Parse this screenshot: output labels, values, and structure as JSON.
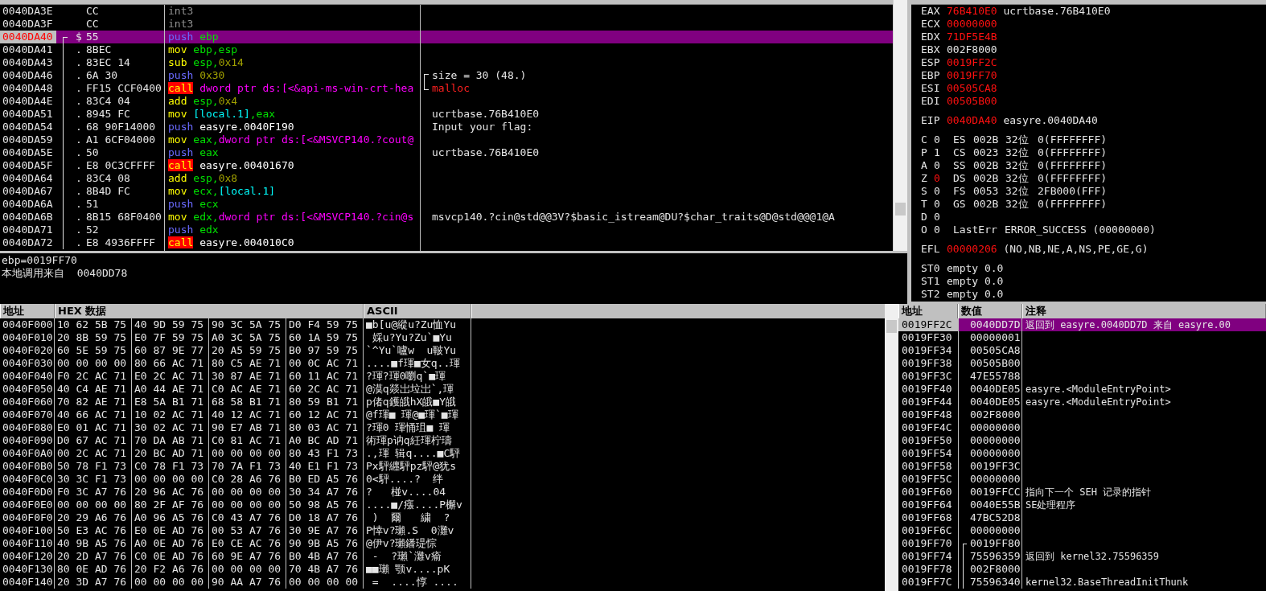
{
  "disassembly": {
    "rows": [
      {
        "address": "0040DA3E",
        "marker": "",
        "in_block": false,
        "hex": "CC",
        "instr": {
          "mnemonic": "int3",
          "kind": "nop"
        },
        "selected": false,
        "current": false
      },
      {
        "address": "0040DA3F",
        "marker": "",
        "in_block": false,
        "hex": "CC",
        "instr": {
          "mnemonic": "int3",
          "kind": "nop"
        },
        "selected": false,
        "current": false
      },
      {
        "address": "0040DA40",
        "marker": "$",
        "in_block": true,
        "hex": "55",
        "instr": {
          "mnemonic": "push",
          "kind": "push",
          "operands": [
            {
              "t": "ebp",
              "kind": "reg"
            }
          ]
        },
        "selected": true,
        "current": true
      },
      {
        "address": "0040DA41",
        "marker": ".",
        "in_block": true,
        "hex": "8BEC",
        "instr": {
          "mnemonic": "mov",
          "kind": "arith",
          "operands": [
            {
              "t": "ebp,esp",
              "kind": "reg"
            }
          ]
        },
        "selected": false,
        "current": false
      },
      {
        "address": "0040DA43",
        "marker": ".",
        "in_block": true,
        "hex": "83EC 14",
        "instr": {
          "mnemonic": "sub",
          "kind": "arith",
          "operands": [
            {
              "t": "esp,",
              "kind": "reg"
            },
            {
              "t": "0x14",
              "kind": "imm"
            }
          ]
        },
        "selected": false,
        "current": false
      },
      {
        "address": "0040DA46",
        "marker": ".",
        "in_block": true,
        "hex": "6A 30",
        "instr": {
          "mnemonic": "push",
          "kind": "push",
          "operands": [
            {
              "t": "0x30",
              "kind": "imm"
            }
          ]
        },
        "selected": false,
        "current": false,
        "comment": {
          "text": "size = 30 (48.)",
          "bracketed": true,
          "kind": "plain"
        }
      },
      {
        "address": "0040DA48",
        "marker": ".",
        "in_block": true,
        "hex": "FF15 CCF0400",
        "instr": {
          "mnemonic": "call",
          "kind": "call",
          "operands": [
            {
              "t": "dword ptr ds:[<&api-ms-win-crt-hea",
              "kind": "mem"
            }
          ]
        },
        "selected": false,
        "current": false,
        "comment": {
          "text": "malloc",
          "bracketed": true,
          "kind": "api"
        }
      },
      {
        "address": "0040DA4E",
        "marker": ".",
        "in_block": true,
        "hex": "83C4 04",
        "instr": {
          "mnemonic": "add",
          "kind": "arith",
          "operands": [
            {
              "t": "esp,",
              "kind": "reg"
            },
            {
              "t": "0x4",
              "kind": "imm"
            }
          ]
        },
        "selected": false,
        "current": false
      },
      {
        "address": "0040DA51",
        "marker": ".",
        "in_block": true,
        "hex": "8945 FC",
        "instr": {
          "mnemonic": "mov",
          "kind": "arith",
          "operands": [
            {
              "t": "[local.1]",
              "kind": "local"
            },
            {
              "t": ",eax",
              "kind": "reg"
            }
          ]
        },
        "selected": false,
        "current": false,
        "comment": {
          "text": "ucrtbase.76B410E0",
          "kind": "plain"
        }
      },
      {
        "address": "0040DA54",
        "marker": ".",
        "in_block": true,
        "hex": "68 90F14000",
        "instr": {
          "mnemonic": "push",
          "kind": "push",
          "operands": [
            {
              "t": "easyre.0040F190",
              "kind": "sym"
            }
          ]
        },
        "selected": false,
        "current": false,
        "comment": {
          "text": "Input your flag:",
          "kind": "plain"
        }
      },
      {
        "address": "0040DA59",
        "marker": ".",
        "in_block": true,
        "hex": "A1 6CF04000",
        "instr": {
          "mnemonic": "mov",
          "kind": "arith",
          "operands": [
            {
              "t": "eax,",
              "kind": "reg"
            },
            {
              "t": "dword ptr ds:[<&MSVCP140.?cout@",
              "kind": "mem"
            }
          ]
        },
        "selected": false,
        "current": false
      },
      {
        "address": "0040DA5E",
        "marker": ".",
        "in_block": true,
        "hex": "50",
        "instr": {
          "mnemonic": "push",
          "kind": "push",
          "operands": [
            {
              "t": "eax",
              "kind": "reg"
            }
          ]
        },
        "selected": false,
        "current": false,
        "comment": {
          "text": "ucrtbase.76B410E0",
          "kind": "plain"
        }
      },
      {
        "address": "0040DA5F",
        "marker": ".",
        "in_block": true,
        "hex": "E8 0C3CFFFF",
        "instr": {
          "mnemonic": "call",
          "kind": "call",
          "operands": [
            {
              "t": "easyre.00401670",
              "kind": "sym"
            }
          ]
        },
        "selected": false,
        "current": false
      },
      {
        "address": "0040DA64",
        "marker": ".",
        "in_block": true,
        "hex": "83C4 08",
        "instr": {
          "mnemonic": "add",
          "kind": "arith",
          "operands": [
            {
              "t": "esp,",
              "kind": "reg"
            },
            {
              "t": "0x8",
              "kind": "imm"
            }
          ]
        },
        "selected": false,
        "current": false
      },
      {
        "address": "0040DA67",
        "marker": ".",
        "in_block": true,
        "hex": "8B4D FC",
        "instr": {
          "mnemonic": "mov",
          "kind": "arith",
          "operands": [
            {
              "t": "ecx,",
              "kind": "reg"
            },
            {
              "t": "[local.1]",
              "kind": "local"
            }
          ]
        },
        "selected": false,
        "current": false
      },
      {
        "address": "0040DA6A",
        "marker": ".",
        "in_block": true,
        "hex": "51",
        "instr": {
          "mnemonic": "push",
          "kind": "push",
          "operands": [
            {
              "t": "ecx",
              "kind": "reg"
            }
          ]
        },
        "selected": false,
        "current": false
      },
      {
        "address": "0040DA6B",
        "marker": ".",
        "in_block": true,
        "hex": "8B15 68F0400",
        "instr": {
          "mnemonic": "mov",
          "kind": "arith",
          "operands": [
            {
              "t": "edx,",
              "kind": "reg"
            },
            {
              "t": "dword ptr ds:[<&MSVCP140.?cin@s",
              "kind": "mem"
            }
          ]
        },
        "selected": false,
        "current": false,
        "comment": {
          "text": "msvcp140.?cin@std@@3V?$basic_istream@DU?$char_traits@D@std@@@1@A",
          "kind": "plain"
        }
      },
      {
        "address": "0040DA71",
        "marker": ".",
        "in_block": true,
        "hex": "52",
        "instr": {
          "mnemonic": "push",
          "kind": "push",
          "operands": [
            {
              "t": "edx",
              "kind": "reg"
            }
          ]
        },
        "selected": false,
        "current": false
      },
      {
        "address": "0040DA72",
        "marker": ".",
        "in_block": true,
        "hex": "E8 4936FFFF",
        "instr": {
          "mnemonic": "call",
          "kind": "call",
          "operands": [
            {
              "t": "easyre.004010C0",
              "kind": "sym"
            }
          ]
        },
        "selected": false,
        "current": false
      }
    ]
  },
  "info": {
    "lines": [
      "ebp=0019FF70",
      "本地调用来自  0040DD78"
    ]
  },
  "registers": {
    "groups": [
      [
        {
          "kind": "reg",
          "name": "EAX",
          "value": "76B410E0",
          "changed": true,
          "comment": "ucrtbase.76B410E0"
        },
        {
          "kind": "reg",
          "name": "ECX",
          "value": "00000000",
          "changed": true
        },
        {
          "kind": "reg",
          "name": "EDX",
          "value": "71DF5E4B",
          "changed": true
        },
        {
          "kind": "reg",
          "name": "EBX",
          "value": "002F8000",
          "changed": false
        },
        {
          "kind": "reg",
          "name": "ESP",
          "value": "0019FF2C",
          "changed": true
        },
        {
          "kind": "reg",
          "name": "EBP",
          "value": "0019FF70",
          "changed": true
        },
        {
          "kind": "reg",
          "name": "ESI",
          "value": "00505CA8",
          "changed": true
        },
        {
          "kind": "reg",
          "name": "EDI",
          "value": "00505B00",
          "changed": true
        }
      ],
      [
        {
          "kind": "reg",
          "name": "EIP",
          "value": "0040DA40",
          "changed": true,
          "comment": "easyre.0040DA40"
        }
      ],
      [
        {
          "kind": "seg",
          "flag": "C",
          "bit": "0",
          "changed": false,
          "seg": "ES",
          "selector": "002B",
          "bits": "32位",
          "base": "0(FFFFFFFF)"
        },
        {
          "kind": "seg",
          "flag": "P",
          "bit": "1",
          "changed": false,
          "seg": "CS",
          "selector": "0023",
          "bits": "32位",
          "base": "0(FFFFFFFF)"
        },
        {
          "kind": "seg",
          "flag": "A",
          "bit": "0",
          "changed": false,
          "seg": "SS",
          "selector": "002B",
          "bits": "32位",
          "base": "0(FFFFFFFF)"
        },
        {
          "kind": "seg",
          "flag": "Z",
          "bit": "0",
          "changed": true,
          "seg": "DS",
          "selector": "002B",
          "bits": "32位",
          "base": "0(FFFFFFFF)"
        },
        {
          "kind": "seg",
          "flag": "S",
          "bit": "0",
          "changed": false,
          "seg": "FS",
          "selector": "0053",
          "bits": "32位",
          "base": "2FB000(FFF)"
        },
        {
          "kind": "seg",
          "flag": "T",
          "bit": "0",
          "changed": false,
          "seg": "GS",
          "selector": "002B",
          "bits": "32位",
          "base": "0(FFFFFFFF)"
        },
        {
          "kind": "flag",
          "flag": "D",
          "bit": "0",
          "changed": false
        },
        {
          "kind": "lasterr",
          "flag": "O",
          "bit": "0",
          "changed": false,
          "label": "LastErr",
          "text": "ERROR_SUCCESS (00000000)"
        }
      ],
      [
        {
          "kind": "reg",
          "name": "EFL",
          "value": "00000206",
          "changed": true,
          "comment": "(NO,NB,NE,A,NS,PE,GE,G)"
        }
      ],
      [
        {
          "kind": "fpu",
          "name": "ST0",
          "text": "empty 0.0"
        },
        {
          "kind": "fpu",
          "name": "ST1",
          "text": "empty 0.0"
        },
        {
          "kind": "fpu",
          "name": "ST2",
          "text": "empty 0.0"
        }
      ]
    ]
  },
  "dump": {
    "columns": [
      "地址",
      "HEX 数据",
      "ASCII"
    ],
    "rows": [
      {
        "address": "0040F000",
        "bytes": [
          "10 62 5B 75",
          "40 9D 59 75",
          "90 3C 5A 75",
          "D0 F4 59 75"
        ],
        "ascii": "■b[u@縱u?Zu恤Yu"
      },
      {
        "address": "0040F010",
        "bytes": [
          "20 8B 59 75",
          "E0 7F 59 75",
          "A0 3C 5A 75",
          "60 1A 59 75"
        ],
        "ascii": " 婇u?Yu?Zu`■Yu"
      },
      {
        "address": "0040F020",
        "bytes": [
          "60 5E 59 75",
          "60 87 9E 77",
          "20 A5 59 75",
          "B0 97 59 75"
        ],
        "ascii": "`^Yu`嚧w  u皸Yu"
      },
      {
        "address": "0040F030",
        "bytes": [
          "00 00 00 00",
          "80 66 AC 71",
          "80 C5 AE 71",
          "00 0C AC 71"
        ],
        "ascii": "....■f琿■女q..琿"
      },
      {
        "address": "0040F040",
        "bytes": [
          "F0 2C AC 71",
          "E0 2C AC 71",
          "30 87 AE 71",
          "60 11 AC 71"
        ],
        "ascii": "?琿?琿0嚠q`■琿"
      },
      {
        "address": "0040F050",
        "bytes": [
          "40 C4 AE 71",
          "A0 44 AE 71",
          "C0 AC AE 71",
          "60 2C AC 71"
        ],
        "ascii": "@漠q燚岀垃岀`,琿"
      },
      {
        "address": "0040F060",
        "bytes": [
          "70 82 AE 71",
          "E8 5A B1 71",
          "68 58 B1 71",
          "80 59 B1 71"
        ],
        "ascii": "p偖q鑊皒hX皒■Y皒"
      },
      {
        "address": "0040F070",
        "bytes": [
          "40 66 AC 71",
          "10 02 AC 71",
          "40 12 AC 71",
          "60 12 AC 71"
        ],
        "ascii": "@f琿■ 琿@■琿`■琿"
      },
      {
        "address": "0040F080",
        "bytes": [
          "E0 01 AC 71",
          "30 02 AC 71",
          "90 E7 AB 71",
          "80 03 AC 71"
        ],
        "ascii": "?琿0 琿悀珇■ 琿"
      },
      {
        "address": "0040F090",
        "bytes": [
          "D0 67 AC 71",
          "70 DA AB 71",
          "C0 81 AC 71",
          "A0 BC AD 71"
        ],
        "ascii": "術琿p讷q紝琿柠璹"
      },
      {
        "address": "0040F0A0",
        "bytes": [
          "00 2C AC 71",
          "20 BC AD 71",
          "00 00 00 00",
          "80 43 F1 73"
        ],
        "ascii": ".,琿 辑q....■C駍"
      },
      {
        "address": "0040F0B0",
        "bytes": [
          "50 78 F1 73",
          "C0 78 F1 73",
          "70 7A F1 73",
          "40 E1 F1 73"
        ],
        "ascii": "Px駍纒駍pz駍@犹s"
      },
      {
        "address": "0040F0C0",
        "bytes": [
          "30 3C F1 73",
          "00 00 00 00",
          "C0 28 A6 76",
          "B0 ED A5 76"
        ],
        "ascii": "0<駍....?  绊"
      },
      {
        "address": "0040F0D0",
        "bytes": [
          "F0 3C A7 76",
          "20 96 AC 76",
          "00 00 00 00",
          "30 34 A7 76"
        ],
        "ascii": "?   椪v....04"
      },
      {
        "address": "0040F0E0",
        "bytes": [
          "00 00 00 00",
          "80 2F AF 76",
          "00 00 00 00",
          "50 98 A5 76"
        ],
        "ascii": "....■/瘬....P檞v"
      },
      {
        "address": "0040F0F0",
        "bytes": [
          "20 29 A6 76",
          "A0 96 A5 76",
          "C0 43 A7 76",
          "D0 18 A7 76"
        ],
        "ascii": " )  爾   繍  ?"
      },
      {
        "address": "0040F100",
        "bytes": [
          "50 E3 AC 76",
          "E0 0E AD 76",
          "00 53 A7 76",
          "30 9E A7 76"
        ],
        "ascii": "P悻v?瓎.S  0灘v"
      },
      {
        "address": "0040F110",
        "bytes": [
          "40 9B A5 76",
          "A0 0E AD 76",
          "E0 CE AC 76",
          "90 9B A5 76"
        ],
        "ascii": "@伊v?瓎鐇瑅悰"
      },
      {
        "address": "0040F120",
        "bytes": [
          "20 2D A7 76",
          "C0 0E AD 76",
          "60 9E A7 76",
          "B0 4B A7 76"
        ],
        "ascii": " -  ?瓎`灘v瘉"
      },
      {
        "address": "0040F130",
        "bytes": [
          "80 0E AD 76",
          "20 F2 A6 76",
          "00 00 00 00",
          "70 4B A7 76"
        ],
        "ascii": "■■瓎 颚v....pK"
      },
      {
        "address": "0040F140",
        "bytes": [
          "20 3D A7 76",
          "00 00 00 00",
          "90 AA A7 76",
          "00 00 00 00"
        ],
        "ascii": " =  ....惇 ...."
      }
    ]
  },
  "stack": {
    "columns": [
      "地址",
      "数值",
      "注释"
    ],
    "rows": [
      {
        "address": "0019FF2C",
        "value": "0040DD7D",
        "in_frame": false,
        "selected": true,
        "comment": "返回到 easyre.0040DD7D 来自 easyre.00"
      },
      {
        "address": "0019FF30",
        "value": "00000001",
        "in_frame": false,
        "selected": false
      },
      {
        "address": "0019FF34",
        "value": "00505CA8",
        "in_frame": false,
        "selected": false
      },
      {
        "address": "0019FF38",
        "value": "00505B00",
        "in_frame": false,
        "selected": false
      },
      {
        "address": "0019FF3C",
        "value": "47E55788",
        "in_frame": false,
        "selected": false
      },
      {
        "address": "0019FF40",
        "value": "0040DE05",
        "in_frame": false,
        "selected": false,
        "comment": "easyre.<ModuleEntryPoint>"
      },
      {
        "address": "0019FF44",
        "value": "0040DE05",
        "in_frame": false,
        "selected": false,
        "comment": "easyre.<ModuleEntryPoint>"
      },
      {
        "address": "0019FF48",
        "value": "002F8000",
        "in_frame": false,
        "selected": false
      },
      {
        "address": "0019FF4C",
        "value": "00000000",
        "in_frame": false,
        "selected": false
      },
      {
        "address": "0019FF50",
        "value": "00000000",
        "in_frame": false,
        "selected": false
      },
      {
        "address": "0019FF54",
        "value": "00000000",
        "in_frame": false,
        "selected": false
      },
      {
        "address": "0019FF58",
        "value": "0019FF3C",
        "in_frame": false,
        "selected": false
      },
      {
        "address": "0019FF5C",
        "value": "00000000",
        "in_frame": false,
        "selected": false
      },
      {
        "address": "0019FF60",
        "value": "0019FFCC",
        "in_frame": false,
        "selected": false,
        "comment": "指向下一个 SEH 记录的指针"
      },
      {
        "address": "0019FF64",
        "value": "0040E55B",
        "in_frame": false,
        "selected": false,
        "comment": "SE处理程序"
      },
      {
        "address": "0019FF68",
        "value": "47BC52D8",
        "in_frame": false,
        "selected": false
      },
      {
        "address": "0019FF6C",
        "value": "00000000",
        "in_frame": false,
        "selected": false
      },
      {
        "address": "0019FF70",
        "value": "0019FF80",
        "in_frame": true,
        "selected": false
      },
      {
        "address": "0019FF74",
        "value": "75596359",
        "in_frame": true,
        "selected": false,
        "comment": "返回到 kernel32.75596359"
      },
      {
        "address": "0019FF78",
        "value": "002F8000",
        "in_frame": true,
        "selected": false
      },
      {
        "address": "0019FF7C",
        "value": "75596340",
        "in_frame": true,
        "selected": false,
        "comment": "kernel32.BaseThreadInitThunk"
      }
    ]
  }
}
